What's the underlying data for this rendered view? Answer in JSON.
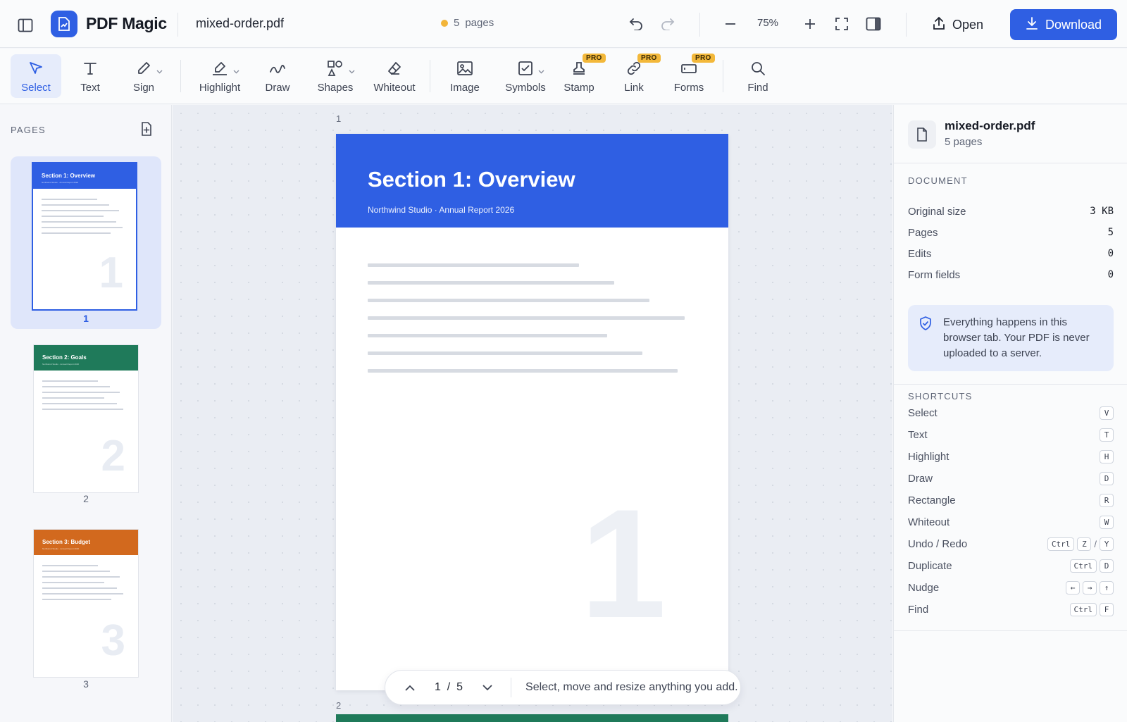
{
  "app": {
    "brand": "PDF Magic",
    "filename": "mixed-order.pdf",
    "page_count": "5",
    "pages_word": "pages",
    "zoom": "75%",
    "open_label": "Open",
    "download_label": "Download",
    "accent_color": "#2f5fe3"
  },
  "toolbar": {
    "tools": [
      {
        "label": "Select",
        "icon": "cursor-icon"
      },
      {
        "label": "Text",
        "icon": "text-icon"
      },
      {
        "label": "Sign",
        "icon": "pen-icon"
      },
      {
        "label": "Highlight",
        "icon": "highlighter-icon"
      },
      {
        "label": "Draw",
        "icon": "squiggle-icon"
      },
      {
        "label": "Shapes",
        "icon": "shapes-icon"
      },
      {
        "label": "Whiteout",
        "icon": "eraser-icon"
      },
      {
        "label": "Image",
        "icon": "image-icon"
      },
      {
        "label": "Symbols",
        "icon": "checkbox-icon"
      },
      {
        "label": "Stamp",
        "icon": "stamp-icon"
      },
      {
        "label": "Link",
        "icon": "link-icon"
      },
      {
        "label": "Forms",
        "icon": "form-icon"
      },
      {
        "label": "Find",
        "icon": "search-icon"
      }
    ],
    "pro_badge": "PRO"
  },
  "sidebar": {
    "heading": "PAGES",
    "thumbnails": [
      {
        "title": "Section 1: Overview",
        "subtitle": "Northwind Studio · Annual Report 2026",
        "number": "1",
        "color": "#2f5fe3"
      },
      {
        "title": "Section 2: Goals",
        "subtitle": "Northwind Studio · Annual Report 2026",
        "number": "2",
        "color": "#1f7a5a"
      },
      {
        "title": "Section 3: Budget",
        "subtitle": "Northwind Studio · Annual Report 2026",
        "number": "3",
        "color": "#d2691e"
      }
    ]
  },
  "canvas": {
    "page_label_1": "1",
    "page_label_2": "2",
    "page": {
      "title": "Section 1: Overview",
      "subtitle": "Northwind Studio  ·  Annual Report 2026",
      "big_number": "1"
    },
    "nav": {
      "current": "1",
      "separator": "/",
      "total": "5",
      "hint": "Select, move and resize anything you add."
    }
  },
  "panel": {
    "file_name": "mixed-order.pdf",
    "file_pages": "5 pages",
    "document_heading": "DOCUMENT",
    "rows": [
      {
        "label": "Original size",
        "value": "3 KB"
      },
      {
        "label": "Pages",
        "value": "5"
      },
      {
        "label": "Edits",
        "value": "0"
      },
      {
        "label": "Form fields",
        "value": "0"
      }
    ],
    "privacy_note": "Everything happens in this browser tab. Your PDF is never uploaded to a server.",
    "shortcuts_heading": "SHORTCUTS",
    "shortcuts": [
      {
        "label": "Select",
        "keys": [
          "V"
        ]
      },
      {
        "label": "Text",
        "keys": [
          "T"
        ]
      },
      {
        "label": "Highlight",
        "keys": [
          "H"
        ]
      },
      {
        "label": "Draw",
        "keys": [
          "D"
        ]
      },
      {
        "label": "Rectangle",
        "keys": [
          "R"
        ]
      },
      {
        "label": "Whiteout",
        "keys": [
          "W"
        ]
      },
      {
        "label": "Undo / Redo",
        "keys": [
          "Ctrl",
          "Z",
          "/",
          "Y"
        ]
      },
      {
        "label": "Duplicate",
        "keys": [
          "Ctrl",
          "D"
        ]
      },
      {
        "label": "Nudge",
        "keys": [
          "←",
          "→",
          "↑"
        ]
      },
      {
        "label": "Find",
        "keys": [
          "Ctrl",
          "F"
        ]
      }
    ]
  }
}
